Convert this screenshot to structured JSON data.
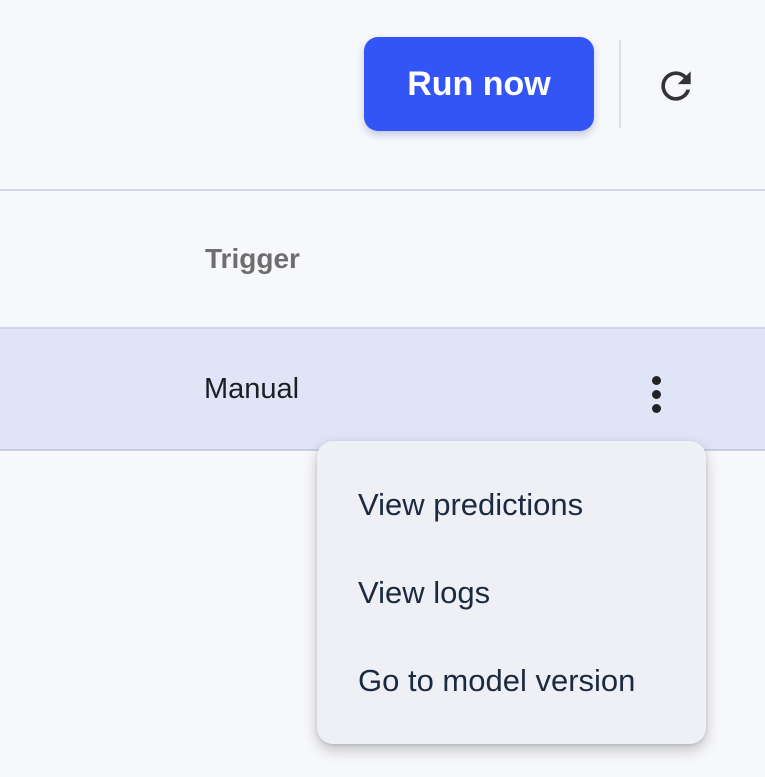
{
  "toolbar": {
    "run_label": "Run now",
    "refresh_icon": "refresh-icon",
    "accent_color": "#3355f5"
  },
  "table": {
    "columns": [
      "Trigger"
    ],
    "rows": [
      {
        "trigger": "Manual",
        "selected": true,
        "actions_icon": "kebab-menu-icon"
      }
    ]
  },
  "context_menu": {
    "items": [
      "View predictions",
      "View logs",
      "Go to model version"
    ]
  }
}
